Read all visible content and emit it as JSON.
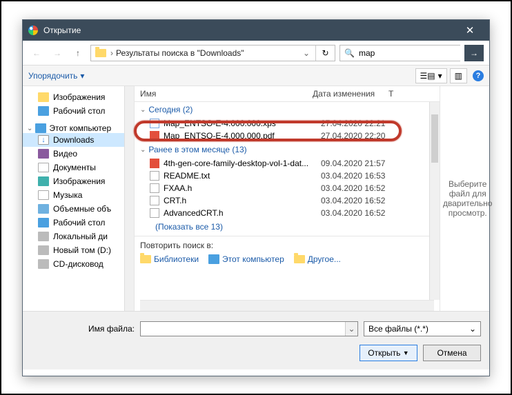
{
  "titlebar": {
    "title": "Открытие"
  },
  "nav": {
    "path_label": "Результаты поиска в \"Downloads\"",
    "search_value": "map"
  },
  "toolbar": {
    "organize": "Упорядочить"
  },
  "sidebar": {
    "items": [
      {
        "label": "Изображения"
      },
      {
        "label": "Рабочий стол"
      },
      {
        "label": "Этот компьютер"
      },
      {
        "label": "Downloads"
      },
      {
        "label": "Видео"
      },
      {
        "label": "Документы"
      },
      {
        "label": "Изображения"
      },
      {
        "label": "Музыка"
      },
      {
        "label": "Объемные объ"
      },
      {
        "label": "Рабочий стол"
      },
      {
        "label": "Локальный ди"
      },
      {
        "label": "Новый том (D:)"
      },
      {
        "label": "CD-дисковод"
      }
    ]
  },
  "columns": {
    "name": "Имя",
    "date": "Дата изменения",
    "type": "Т"
  },
  "groups": [
    {
      "title": "Сегодня (2)",
      "rows": [
        {
          "name": "Map_ENTSO-E-4.000.000.xps",
          "date": "27.04.2020 22:21",
          "icon": "xps"
        },
        {
          "name": "Map_ENTSO-E-4.000.000.pdf",
          "date": "27.04.2020 22:20",
          "icon": "pdf"
        }
      ]
    },
    {
      "title": "Ранее в этом месяце (13)",
      "rows": [
        {
          "name": "4th-gen-core-family-desktop-vol-1-dat...",
          "date": "09.04.2020 21:57",
          "icon": "pdf"
        },
        {
          "name": "README.txt",
          "date": "03.04.2020 16:53",
          "icon": "doc"
        },
        {
          "name": "FXAA.h",
          "date": "03.04.2020 16:52",
          "icon": "doc"
        },
        {
          "name": "CRT.h",
          "date": "03.04.2020 16:52",
          "icon": "doc"
        },
        {
          "name": "AdvancedCRT.h",
          "date": "03.04.2020 16:52",
          "icon": "doc"
        }
      ]
    }
  ],
  "show_more": "(Показать все 13)",
  "repeat": {
    "label": "Повторить поиск в:",
    "opts": [
      "Библиотеки",
      "Этот компьютер",
      "Другое..."
    ]
  },
  "preview": "Выберите файл для дварительно просмотр.",
  "footer": {
    "filename_label": "Имя файла:",
    "filter": "Все файлы (*.*)",
    "open": "Открыть",
    "cancel": "Отмена"
  }
}
